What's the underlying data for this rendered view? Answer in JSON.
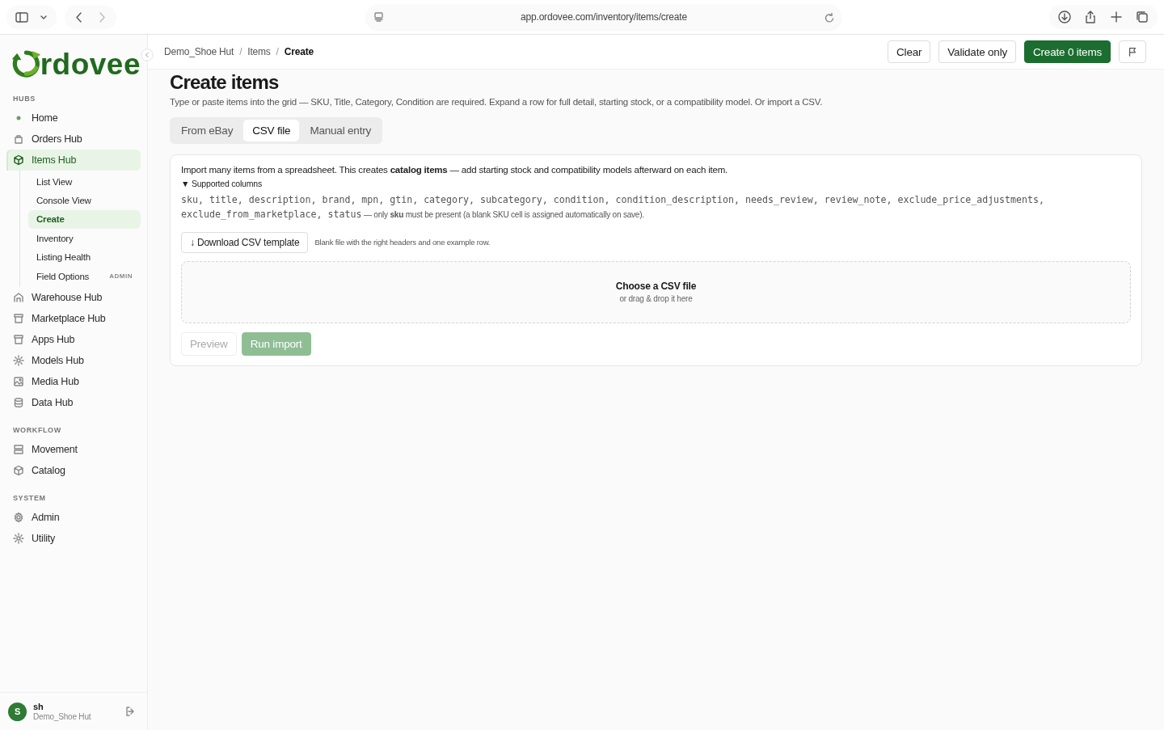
{
  "browser": {
    "url": "app.ordovee.com/inventory/items/create"
  },
  "sidebar": {
    "logo_text": "rdovee",
    "sections": [
      {
        "heading": "HUBS",
        "items": [
          {
            "label": "Home",
            "selected": false
          },
          {
            "label": "Orders Hub",
            "selected": false
          },
          {
            "label": "Items Hub",
            "selected": true,
            "expanded": true,
            "children": [
              {
                "label": "List View",
                "selected": false
              },
              {
                "label": "Console View",
                "selected": false
              },
              {
                "label": "Create",
                "selected": true
              },
              {
                "label": "Inventory",
                "selected": false
              },
              {
                "label": "Listing Health",
                "selected": false
              },
              {
                "label": "Field Options",
                "selected": false,
                "badge": "ADMIN"
              }
            ]
          },
          {
            "label": "Warehouse Hub",
            "selected": false
          },
          {
            "label": "Marketplace Hub",
            "selected": false
          },
          {
            "label": "Apps Hub",
            "selected": false
          },
          {
            "label": "Models Hub",
            "selected": false
          },
          {
            "label": "Media Hub",
            "selected": false
          },
          {
            "label": "Data Hub",
            "selected": false
          }
        ]
      },
      {
        "heading": "WORKFLOW",
        "items": [
          {
            "label": "Movement",
            "selected": false
          },
          {
            "label": "Catalog",
            "selected": false
          }
        ]
      },
      {
        "heading": "SYSTEM",
        "items": [
          {
            "label": "Admin",
            "selected": false
          },
          {
            "label": "Utility",
            "selected": false
          }
        ]
      }
    ],
    "user": {
      "initial": "S",
      "name": "sh",
      "org": "Demo_Shoe Hut"
    }
  },
  "header": {
    "separator": "/",
    "breadcrumbs": [
      {
        "label": "Demo_Shoe Hut",
        "current": false
      },
      {
        "label": "Items",
        "current": false
      },
      {
        "label": "Create",
        "current": true
      }
    ],
    "actions": [
      {
        "label": "Clear",
        "kind": "secondary"
      },
      {
        "label": "Validate only",
        "kind": "secondary"
      },
      {
        "label": "Create 0 items",
        "kind": "primary"
      },
      {
        "kind": "flag"
      }
    ]
  },
  "page": {
    "title": "Create items",
    "subtitle": "Type or paste items into the grid — SKU, Title, Category, Condition are required. Expand a row for full detail, starting stock, or a compatibility model. Or import a CSV.",
    "tabs": [
      {
        "label": "From eBay",
        "selected": false
      },
      {
        "label": "CSV file",
        "selected": true
      },
      {
        "label": "Manual entry",
        "selected": false
      }
    ],
    "card": {
      "intro": "Import many items from a spreadsheet. This creates **catalog items** — add starting stock and compatibility models afterward on each item.",
      "details": {
        "marker": "▼",
        "summary": "Supported columns",
        "expanded": true,
        "columns": "sku, title, description, brand, mpn, gtin, category, subcategory, condition, condition_description, needs_review, review_note, exclude_price_adjustments, exclude_from_marketplace, status",
        "note": " — only **sku** must be present (a blank SKU cell is assigned automatically on save)."
      },
      "download_button": "↓ Download CSV template",
      "download_hint": "Blank file with the right headers and one example row.",
      "dropzone": {
        "title": "Choose a CSV file",
        "subtitle": "or drag & drop it here"
      },
      "buttons": [
        {
          "label": "Preview",
          "kind": "secondary",
          "disabled": true
        },
        {
          "label": "Run import",
          "kind": "primary",
          "disabled": true
        }
      ]
    }
  }
}
